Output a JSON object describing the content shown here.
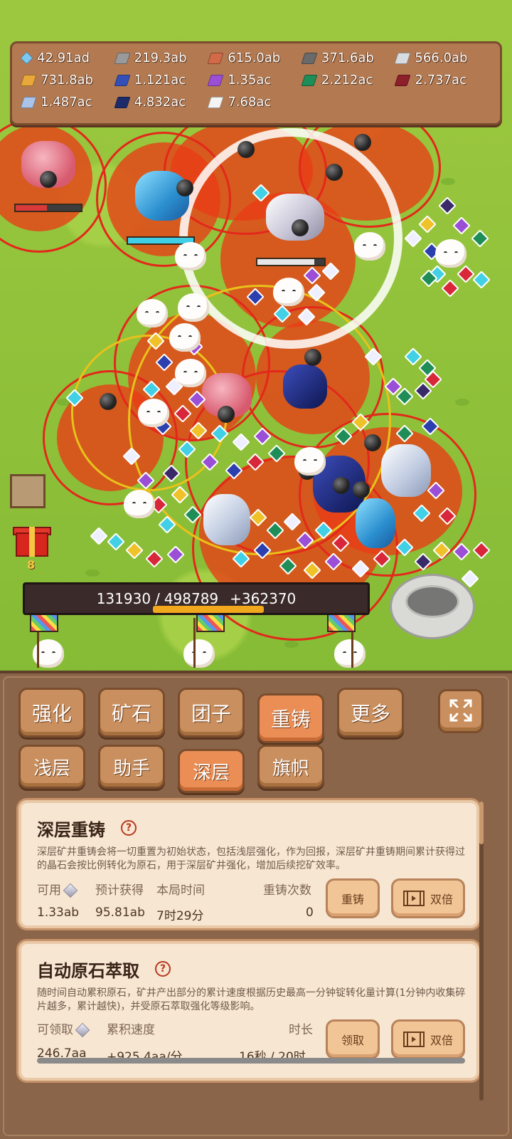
{
  "resources": [
    {
      "icon": "blue-gem-icon",
      "color": "#7cc8f2",
      "value": "42.91ad",
      "gem": true
    },
    {
      "icon": "iron-ingot-icon",
      "color": "#9a9a9a",
      "value": "219.3ab"
    },
    {
      "icon": "copper-ingot-icon",
      "color": "#d26a48",
      "value": "615.0ab"
    },
    {
      "icon": "dark-ingot-icon",
      "color": "#6a6a6a",
      "value": "371.6ab"
    },
    {
      "icon": "silver-ingot-icon",
      "color": "#d8dbe0",
      "value": "566.0ab"
    },
    {
      "icon": "gold-ingot-icon",
      "color": "#e9a93a",
      "value": "731.8ab"
    },
    {
      "icon": "sapphire-ingot-icon",
      "color": "#3450b8",
      "value": "1.121ac"
    },
    {
      "icon": "amethyst-ingot-icon",
      "color": "#9b4fd6",
      "value": "1.35ac"
    },
    {
      "icon": "emerald-ingot-icon",
      "color": "#1f8d57",
      "value": "2.212ac"
    },
    {
      "icon": "ruby-ingot-icon",
      "color": "#8d1f2a",
      "value": "2.737ac"
    },
    {
      "icon": "crystal-ingot-icon",
      "color": "#a9c4e8",
      "value": "1.487ac"
    },
    {
      "icon": "navy-ingot-icon",
      "color": "#1e2b6b",
      "value": "4.832ac"
    },
    {
      "icon": "white-ingot-icon",
      "color": "#f4f4f4",
      "value": "7.68ac"
    }
  ],
  "progress": {
    "current": "131930",
    "sep": "/",
    "total": "498789",
    "gain": "+362370"
  },
  "gift_count": "8",
  "tabs": [
    {
      "label": "强化",
      "active": false
    },
    {
      "label": "矿石",
      "active": false
    },
    {
      "label": "团子",
      "active": false
    },
    {
      "label": "重铸",
      "active": true
    },
    {
      "label": "更多",
      "active": false
    }
  ],
  "subtabs": [
    {
      "label": "浅层",
      "active": false
    },
    {
      "label": "助手",
      "active": false
    },
    {
      "label": "深层",
      "active": true
    },
    {
      "label": "旗帜",
      "active": false
    }
  ],
  "reforge": {
    "title": "深层重铸",
    "help": "?",
    "desc": "深层矿井重铸会将一切重置为初始状态，包括浅层强化，作为回报，深层矿井重铸期间累计获得过的晶石会按比例转化为原石，用于深层矿井强化，增加后续挖矿效率。",
    "available_label": "可用",
    "expected_label": "预计获得",
    "time_label": "本局时间",
    "count_label": "重铸次数",
    "available_value": "1.33ab",
    "expected_value": "95.81ab",
    "time_value": "7时29分",
    "count_value": "0",
    "reforge_button": "重铸",
    "double_button": "双倍"
  },
  "extract": {
    "title": "自动原石萃取",
    "help": "?",
    "desc": "随时间自动累积原石，矿井产出部分的累计速度根据历史最高一分钟锭转化量计算(1分钟内收集碎片越多，累计越快)，并受原石萃取强化等级影响。",
    "claimable_label": "可领取",
    "rate_label": "累积速度",
    "duration_label": "时长",
    "claimable_value": "246.7aa",
    "rate_value": "+925.4aa/分",
    "duration_value": "16秒 / 20时",
    "fill_fraction": 0.0,
    "claim_button": "领取",
    "double_button": "双倍"
  }
}
